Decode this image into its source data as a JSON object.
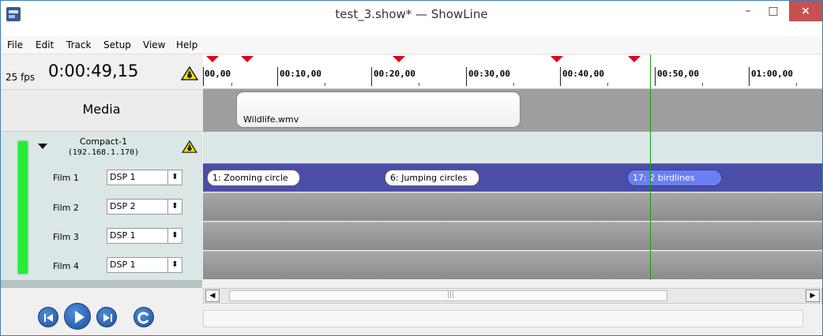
{
  "window": {
    "title": "test_3.show* — ShowLine",
    "minimize_glyph": "–",
    "maximize_glyph": "□",
    "close_glyph": "×"
  },
  "menu": {
    "items": [
      "File",
      "Edit",
      "Track",
      "Setup",
      "View",
      "Help"
    ]
  },
  "header": {
    "fps": "25 fps",
    "timecode": "0:00:49,15",
    "warning_icon": "warning-triangle-icon"
  },
  "ruler": {
    "labels": [
      "00,00",
      "00:10,00",
      "00:20,00",
      "00:30,00",
      "00:40,00",
      "00:50,00",
      "01:00,00"
    ],
    "marker_color": "#e0001a"
  },
  "media": {
    "label": "Media",
    "clip_label": "Wildlife.wmv"
  },
  "device": {
    "name": "Compact-1",
    "ip": "(192.168.1.170)",
    "status_color": "#22ee33",
    "warning_icon": "warning-triangle-icon"
  },
  "tracks": [
    {
      "label": "Film 1",
      "dsp": "DSP 1"
    },
    {
      "label": "Film 2",
      "dsp": "DSP 2"
    },
    {
      "label": "Film 3",
      "dsp": "DSP 1"
    },
    {
      "label": "Film 4",
      "dsp": "DSP 1"
    }
  ],
  "cues": [
    {
      "label": "1: Zooming circle"
    },
    {
      "label": "6: Jumping circles"
    },
    {
      "label": "17: 2 birdlines"
    }
  ],
  "transport": {
    "buttons": [
      "rewind-icon",
      "play-icon",
      "fast-forward-icon",
      "loop-icon"
    ]
  },
  "colors": {
    "track_active": "#4a4ea6",
    "playhead": "#10a010"
  }
}
